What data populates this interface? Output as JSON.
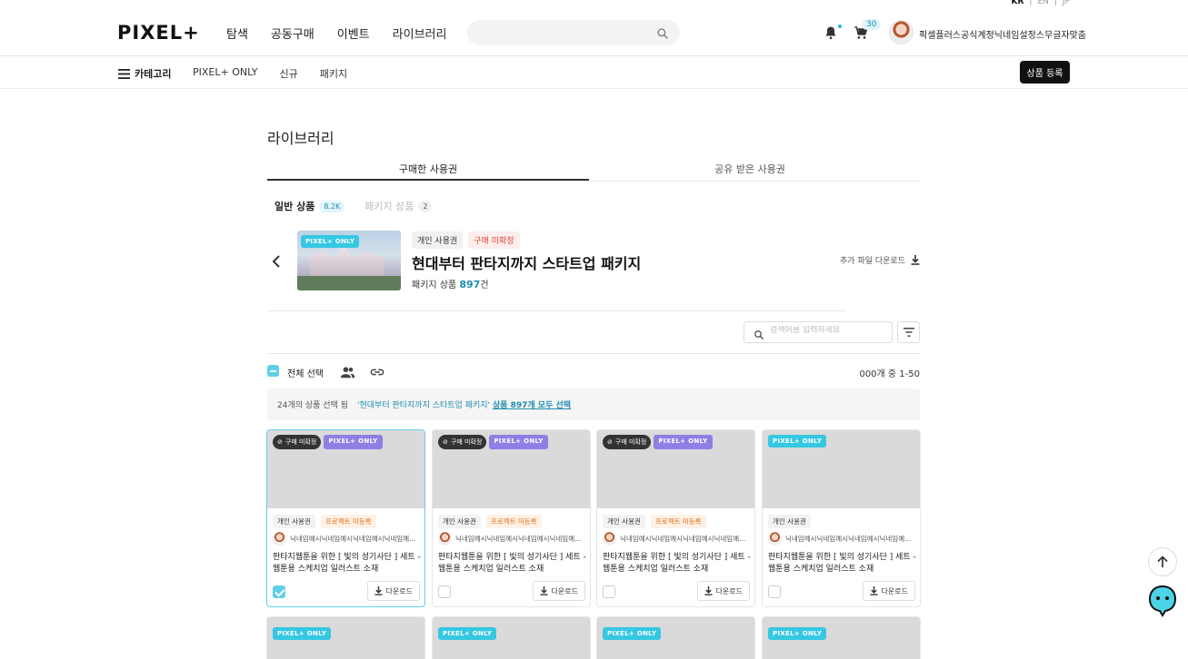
{
  "lang": {
    "kr": "KR",
    "en": "EN",
    "jp": "JP",
    "sep": "|"
  },
  "header": {
    "logo": "PIXEL+",
    "nav": [
      "탐색",
      "공동구매",
      "이벤트",
      "라이브러리"
    ],
    "search_placeholder": "",
    "cart_count": "30",
    "username": "픽셀플러스공식계정닉네임설정스무글자맞춤"
  },
  "subnav": {
    "category": "카테고리",
    "items": [
      "PIXEL+ ONLY",
      "신규",
      "패키지"
    ],
    "register_button": "상품 등록"
  },
  "page": {
    "title": "라이브러리",
    "tabs": [
      "구매한 사용권",
      "공유 받은 사용권"
    ],
    "active_tab": 0,
    "subtabs": [
      {
        "label": "일반 상품",
        "count": "8.2K"
      },
      {
        "label": "패키지 상품",
        "count": "2"
      }
    ]
  },
  "package": {
    "thumb_tag": "PIXEL+ ONLY",
    "badges": [
      "개인 사용권",
      "구매 미확정"
    ],
    "title": "현대부터 판타지까지 스타트업 패키지",
    "sub_prefix": "패키지 상품",
    "sub_count": "897",
    "sub_suffix": "건",
    "extra_download": "추가 파일 다운로드"
  },
  "toolbar": {
    "search_placeholder": "검색어를 입력하세요",
    "select_all": "전체 선택",
    "result_count": "000개 중 1-50"
  },
  "notice": {
    "prefix": "24개의 상품 선택 됨",
    "quote": "'현대부터 판타지까지 스타트업 패키지'",
    "link": "상품 897개 모두 선택"
  },
  "cards": [
    {
      "status": "구매 미확정",
      "tag": "PIXEL+ ONLY",
      "license": "개인 사용권",
      "project": "프로젝트 미등록",
      "author": "닉네임예시닉네임예시닉네임예시닉네임예...",
      "title": "판타지웹툰을 위한 [ 빛의 성기사단 ] 세트 - 웹툰용 스케치업 일러스트 소재",
      "download": "다운로드",
      "checked": true
    },
    {
      "status": "구매 미확정",
      "tag": "PIXEL+ ONLY",
      "license": "개인 사용권",
      "project": "프로젝트 미등록",
      "author": "닉네임예시닉네임예시닉네임예시닉네임예...",
      "title": "판타지웹툰을 위한 [ 빛의 성기사단 ] 세트 - 웹툰용 스케치업 일러스트 소재",
      "download": "다운로드",
      "checked": false
    },
    {
      "status": "구매 미확정",
      "tag": "PIXEL+ ONLY",
      "license": "개인 사용권",
      "project": "프로젝트 미등록",
      "author": "닉네임예시닉네임예시닉네임예시닉네임예...",
      "title": "판타지웹툰을 위한 [ 빛의 성기사단 ] 세트 - 웹툰용 스케치업 일러스트 소재",
      "download": "다운로드",
      "checked": false
    },
    {
      "status": "",
      "tag": "PIXEL+ ONLY",
      "license": "개인 사용권",
      "project": "",
      "author": "닉네임예시닉네임예시닉네임예시닉네임예...",
      "title": "판타지웹툰을 위한 [ 빛의 성기사단 ] 세트 - 웹툰용 스케치업 일러스트 소재",
      "download": "다운로드",
      "checked": false
    }
  ],
  "cards_row2_tag": "PIXEL+ ONLY",
  "colors": {
    "accent": "#1f8db0",
    "cyan": "#5fd0e6",
    "purple": "#8e7fe5",
    "orange": "#e46f12",
    "red": "#e04335"
  }
}
